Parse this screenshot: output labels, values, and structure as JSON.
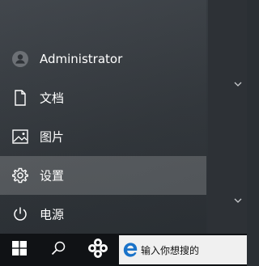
{
  "start_menu": {
    "user": {
      "name": "Administrator",
      "icon": "user-avatar-icon"
    },
    "items": [
      {
        "label": "文档",
        "icon": "document-icon"
      },
      {
        "label": "图片",
        "icon": "pictures-icon"
      },
      {
        "label": "设置",
        "icon": "settings-gear-icon",
        "selected": true
      },
      {
        "label": "电源",
        "icon": "power-icon"
      }
    ]
  },
  "taskbar": {
    "start": {
      "icon": "windows-logo-icon"
    },
    "search": {
      "icon": "search-icon"
    },
    "app": {
      "icon": "pinwheel-app-icon"
    },
    "search_box": {
      "placeholder": "输入你想搜的",
      "icon": "edge-browser-icon"
    }
  },
  "colors": {
    "menu_bg": "#30353a",
    "selected_bg": "#5a5e63",
    "taskbar_bg": "#101215",
    "text": "#ffffff",
    "edge_blue": "#1a73c9"
  }
}
